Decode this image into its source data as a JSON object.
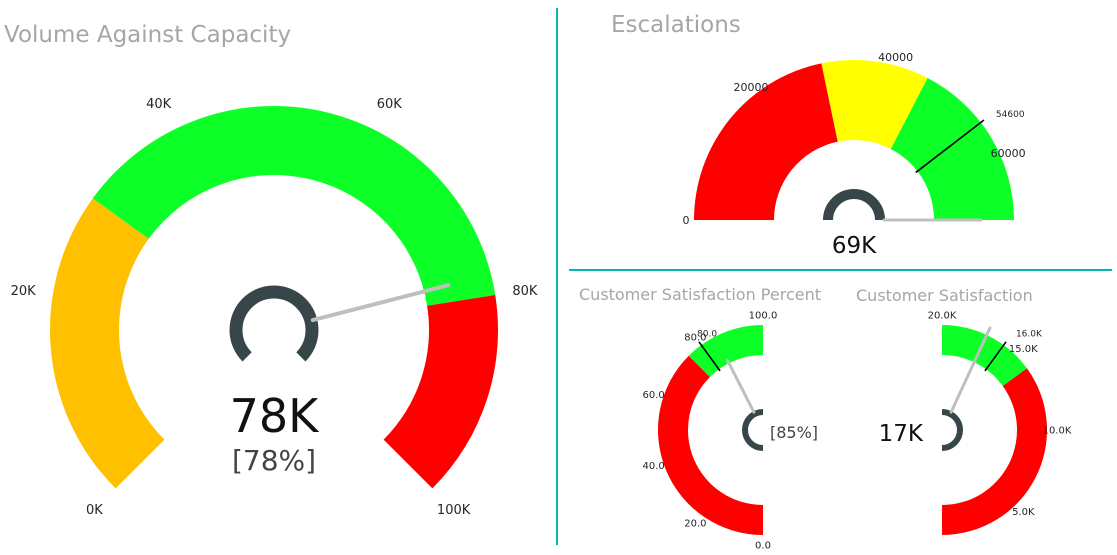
{
  "colors": {
    "green": "#0cff26",
    "yellow": "#ffff00",
    "red": "#ff0000",
    "orange": "#ffc000",
    "hub": "#374649",
    "needle": "#bfbfbf",
    "divider": "#01b8aa",
    "target": "#000000"
  },
  "chart_data": [
    {
      "type": "gauge",
      "title": "Volume Against Capacity",
      "min": 0,
      "max": 100000,
      "value": 78000,
      "value_label": "78K",
      "percent_label": "[78%]",
      "bands": [
        {
          "from": 0,
          "to": 30000,
          "color": "#ffc000"
        },
        {
          "from": 30000,
          "to": 80000,
          "color": "#0cff26"
        },
        {
          "from": 80000,
          "to": 100000,
          "color": "#ff0000"
        }
      ],
      "ticks": [
        {
          "value": 0,
          "label": "0K"
        },
        {
          "value": 20000,
          "label": "20K"
        },
        {
          "value": 40000,
          "label": "40K"
        },
        {
          "value": 60000,
          "label": "60K"
        },
        {
          "value": 80000,
          "label": "80K"
        },
        {
          "value": 100000,
          "label": "100K"
        }
      ]
    },
    {
      "type": "gauge",
      "title": "Escalations",
      "min": 0,
      "max": 69000,
      "value": 69000,
      "value_label": "69K",
      "target": 54600,
      "target_label": "54600",
      "bands": [
        {
          "from": 0,
          "to": 30000,
          "color": "#ff0000"
        },
        {
          "from": 30000,
          "to": 45000,
          "color": "#ffff00"
        },
        {
          "from": 45000,
          "to": 69000,
          "color": "#0cff26"
        }
      ],
      "ticks": [
        {
          "value": 0,
          "label": "0"
        },
        {
          "value": 20000,
          "label": "20000"
        },
        {
          "value": 40000,
          "label": "40000"
        },
        {
          "value": 60000,
          "label": "60000"
        }
      ]
    },
    {
      "type": "gauge",
      "title": "Customer Satisfaction Percent",
      "min": 0,
      "max": 100,
      "value": 85,
      "percent_label": "[85%]",
      "target": 80,
      "target_label": "80.0",
      "bands": [
        {
          "from": 0,
          "to": 75,
          "color": "#ff0000"
        },
        {
          "from": 75,
          "to": 100,
          "color": "#0cff26"
        }
      ],
      "ticks": [
        {
          "value": 0,
          "label": "0.0"
        },
        {
          "value": 20,
          "label": "20.0"
        },
        {
          "value": 40,
          "label": "40.0"
        },
        {
          "value": 60,
          "label": "60.0"
        },
        {
          "value": 80,
          "label": "80.0"
        },
        {
          "value": 100,
          "label": "100.0"
        }
      ]
    },
    {
      "type": "gauge",
      "title": "Customer Satisfaction",
      "min": 0,
      "max": 20,
      "value": 17,
      "value_label": "17K",
      "target": 16,
      "target_label": "16.0K",
      "bands": [
        {
          "from": 0,
          "to": 14,
          "color": "#ff0000"
        },
        {
          "from": 14,
          "to": 20,
          "color": "#0cff26"
        }
      ],
      "ticks": [
        {
          "value": 5,
          "label": "5.0K"
        },
        {
          "value": 10,
          "label": "10.0K"
        },
        {
          "value": 15,
          "label": "15.0K"
        },
        {
          "value": 20,
          "label": "20.0K"
        }
      ]
    }
  ]
}
